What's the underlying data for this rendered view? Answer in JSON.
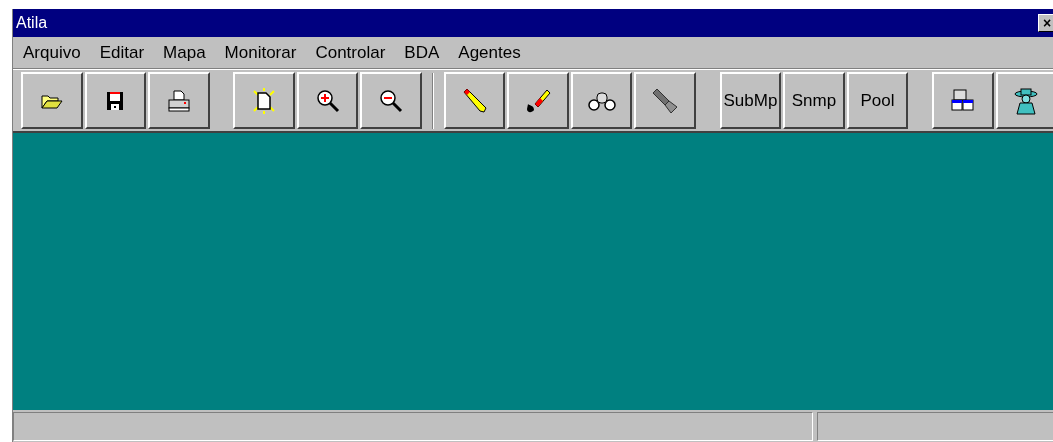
{
  "window": {
    "title": "Atila",
    "close": "×"
  },
  "menu": [
    "Arquivo",
    "Editar",
    "Mapa",
    "Monitorar",
    "Controlar",
    "BDA",
    "Agentes"
  ],
  "toolbar": [
    {
      "kind": "icon"
    },
    {
      "kind": "icon"
    },
    {
      "kind": "icon"
    },
    {
      "kind": "gap"
    },
    {
      "kind": "icon"
    },
    {
      "kind": "icon"
    },
    {
      "kind": "icon"
    },
    {
      "kind": "separator"
    },
    {
      "kind": "icon"
    },
    {
      "kind": "icon"
    },
    {
      "kind": "icon"
    },
    {
      "kind": "icon"
    },
    {
      "kind": "gap"
    },
    {
      "kind": "text",
      "label": "SubMp"
    },
    {
      "kind": "text",
      "label": "Snmp"
    },
    {
      "kind": "text",
      "label": "Pool"
    },
    {
      "kind": "gap"
    },
    {
      "kind": "icon"
    },
    {
      "kind": "icon"
    }
  ]
}
